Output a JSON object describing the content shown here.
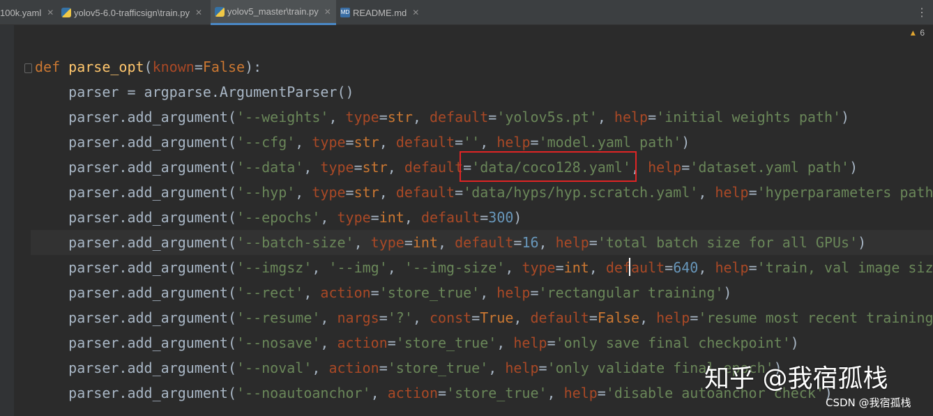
{
  "tabs": [
    {
      "label": "100k.yaml",
      "icon": "yaml-file-icon",
      "active": false
    },
    {
      "label": "yolov5-6.0-trafficsign\\train.py",
      "icon": "python-file-icon",
      "active": false
    },
    {
      "label": "yolov5_master\\train.py",
      "icon": "python-file-icon",
      "active": true
    },
    {
      "label": "README.md",
      "icon": "markdown-file-icon",
      "active": false
    }
  ],
  "inspection": {
    "warning_count": "6"
  },
  "code": [
    {
      "text": "def parse_opt(known=False):"
    },
    {
      "text": "    parser = argparse.ArgumentParser()"
    },
    {
      "text": "    parser.add_argument('--weights', type=str, default='yolov5s.pt', help='initial weights path')"
    },
    {
      "text": "    parser.add_argument('--cfg', type=str, default='', help='model.yaml path')"
    },
    {
      "text": "    parser.add_argument('--data', type=str, default='data/coco128.yaml', help='dataset.yaml path')"
    },
    {
      "text": "    parser.add_argument('--hyp', type=str, default='data/hyps/hyp.scratch.yaml', help='hyperparameters path"
    },
    {
      "text": "    parser.add_argument('--epochs', type=int, default=300)"
    },
    {
      "text": "    parser.add_argument('--batch-size', type=int, default=16, help='total batch size for all GPUs')"
    },
    {
      "text": "    parser.add_argument('--imgsz', '--img', '--img-size', type=int, default=640, help='train, val image size"
    },
    {
      "text": "    parser.add_argument('--rect', action='store_true', help='rectangular training')"
    },
    {
      "text": "    parser.add_argument('--resume', nargs='?', const=True, default=False, help='resume most recent training"
    },
    {
      "text": "    parser.add_argument('--nosave', action='store_true', help='only save final checkpoint')"
    },
    {
      "text": "    parser.add_argument('--noval', action='store_true', help='only validate final epoch')"
    },
    {
      "text": "    parser.add_argument('--noautoanchor', action='store_true', help='disable autoanchor check')"
    }
  ],
  "overlays": {
    "watermark": "知乎 @我宿孤栈",
    "csdn_credit": "CSDN @我宿孤栈"
  },
  "colors": {
    "background": "#2b2b2b",
    "keyword": "#cc7832",
    "function": "#ffc66d",
    "string": "#6a8759",
    "param": "#aa4926",
    "number": "#6897bb",
    "highlight_box": "#e02424"
  }
}
